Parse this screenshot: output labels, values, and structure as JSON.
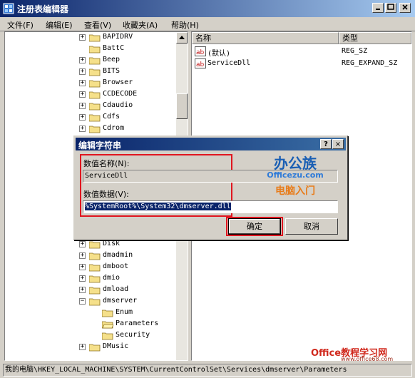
{
  "window": {
    "title": "注册表编辑器"
  },
  "menu": [
    {
      "label": "文件(F)"
    },
    {
      "label": "编辑(E)"
    },
    {
      "label": "查看(V)"
    },
    {
      "label": "收藏夹(A)"
    },
    {
      "label": "帮助(H)"
    }
  ],
  "tree": {
    "top_nodes": [
      {
        "label": "BAPIDRV",
        "expandable": true
      },
      {
        "label": "BattC",
        "expandable": false
      },
      {
        "label": "Beep",
        "expandable": true
      },
      {
        "label": "BITS",
        "expandable": true
      },
      {
        "label": "Browser",
        "expandable": true
      },
      {
        "label": "CCDECODE",
        "expandable": true
      },
      {
        "label": "Cdaudio",
        "expandable": true
      },
      {
        "label": "Cdfs",
        "expandable": true
      },
      {
        "label": "Cdrom",
        "expandable": true
      }
    ],
    "bottom_nodes": [
      {
        "label": "Disk",
        "expandable": true,
        "indent": 0
      },
      {
        "label": "dmadmin",
        "expandable": true,
        "indent": 0
      },
      {
        "label": "dmboot",
        "expandable": true,
        "indent": 0
      },
      {
        "label": "dmio",
        "expandable": true,
        "indent": 0
      },
      {
        "label": "dmload",
        "expandable": true,
        "indent": 0
      },
      {
        "label": "dmserver",
        "expandable": true,
        "expanded": true,
        "indent": 0
      },
      {
        "label": "Enum",
        "expandable": false,
        "indent": 1
      },
      {
        "label": "Parameters",
        "expandable": false,
        "indent": 1,
        "open": true
      },
      {
        "label": "Security",
        "expandable": false,
        "indent": 1
      },
      {
        "label": "DMusic",
        "expandable": true,
        "indent": 0
      }
    ]
  },
  "list": {
    "columns": [
      {
        "label": "名称"
      },
      {
        "label": "类型"
      }
    ],
    "rows": [
      {
        "name": "(默认)",
        "type": "REG_SZ"
      },
      {
        "name": "ServiceDll",
        "type": "REG_EXPAND_SZ"
      }
    ]
  },
  "dialog": {
    "title": "编辑字符串",
    "help_label": "?",
    "close_label": "×",
    "name_label": "数值名称(N):",
    "name_value": "ServiceDll",
    "data_label": "数值数据(V):",
    "data_value": "%SystemRoot%\\System32\\dmserver.dll",
    "ok_label": "确定",
    "cancel_label": "取消"
  },
  "watermark": {
    "brand_cn": "办公族",
    "brand_url": "Officezu.com",
    "sub": "电脑入门",
    "corner_text": "Office教程学习网",
    "corner_url": "www.office68.com"
  },
  "status": {
    "path": "我的电脑\\HKEY_LOCAL_MACHINE\\SYSTEM\\CurrentControlSet\\Services\\dmserver\\Parameters"
  },
  "colors": {
    "titlebar": "#0a246a",
    "highlight": "#e0151f",
    "selection": "#0a246a"
  }
}
